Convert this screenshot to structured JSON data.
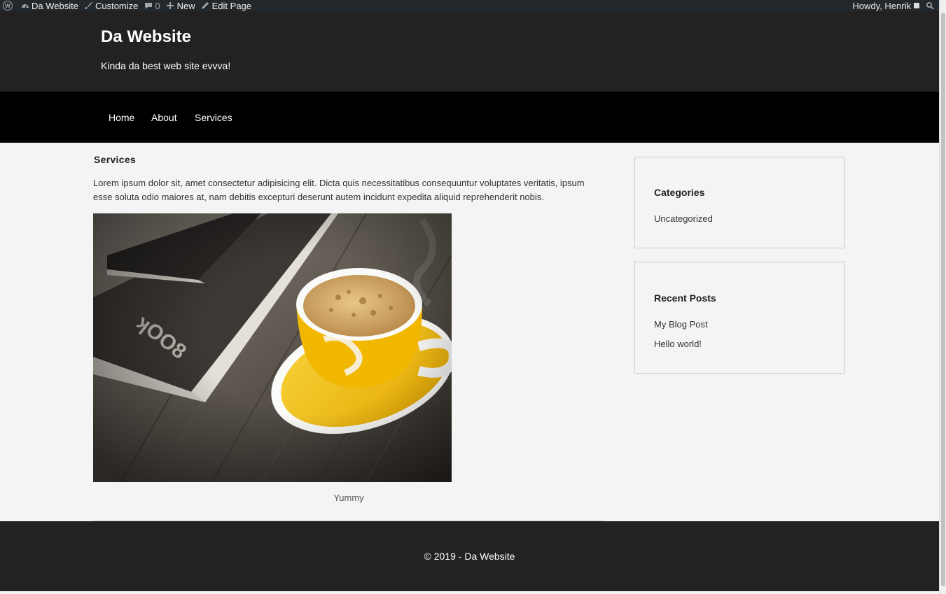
{
  "admin_bar": {
    "site_name": "Da Website",
    "customize": "Customize",
    "comments_count": "0",
    "new": "New",
    "edit_page": "Edit Page",
    "greeting": "Howdy, Henrik"
  },
  "header": {
    "site_title": "Da Website",
    "tagline": "Kinda da best web site evvva!"
  },
  "nav": {
    "items": [
      "Home",
      "About",
      "Services"
    ]
  },
  "page": {
    "title": "Services",
    "body": "Lorem ipsum dolor sit, amet consectetur adipisicing elit. Dicta quis necessitatibus consequuntur voluptates veritatis, ipsum esse soluta odio maiores at, nam debitis excepturi deserunt autem incidunt expedita aliquid reprehenderit nobis.",
    "image_caption": "Yummy"
  },
  "sidebar": {
    "categories": {
      "title": "Categories",
      "items": [
        "Uncategorized"
      ]
    },
    "recent_posts": {
      "title": "Recent Posts",
      "items": [
        "My Blog Post",
        "Hello world!"
      ]
    }
  },
  "footer": {
    "text": "© 2019 - Da Website"
  },
  "colors": {
    "admin_bar": "#23282d",
    "header": "#222222",
    "nav": "#000000",
    "page_bg": "#f4f4f4",
    "cup_yellow": "#f4c20d"
  }
}
